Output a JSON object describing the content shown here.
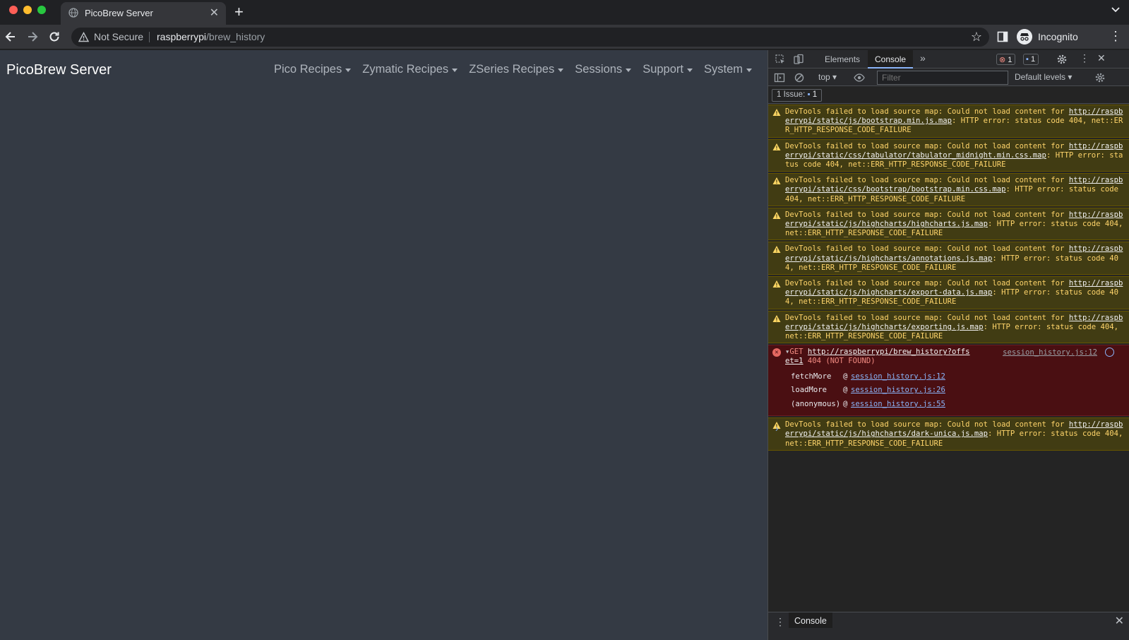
{
  "browser": {
    "tab_title": "PicoBrew Server",
    "security_label": "Not Secure",
    "url_host": "raspberrypi",
    "url_path": "/brew_history",
    "profile_label": "Incognito"
  },
  "page": {
    "brand": "PicoBrew Server",
    "nav": [
      "Pico Recipes",
      "Zymatic Recipes",
      "ZSeries Recipes",
      "Sessions",
      "Support",
      "System"
    ]
  },
  "devtools": {
    "tabs": [
      "Elements",
      "Console"
    ],
    "active_tab": "Console",
    "error_count": "1",
    "message_count": "1",
    "context": "top",
    "filter_placeholder": "Filter",
    "levels": "Default levels",
    "issues_label": "1 Issue:",
    "issues_count": "1",
    "warning_prefix": "DevTools failed to load source map: Could not load content for",
    "warnings": [
      {
        "url": "http://raspberrypi/static/js/bootstrap.min.js.map",
        "suffix": ": HTTP error: status code 404, net::ERR_HTTP_RESPONSE_CODE_FAILURE"
      },
      {
        "url": "http://raspberrypi/static/css/tabulator/tabulator_midnight.min.css.map",
        "suffix": ": HTTP error: status code 404, net::ERR_HTTP_RESPONSE_CODE_FAILURE"
      },
      {
        "url": "http://raspberrypi/static/css/bootstrap/bootstrap.min.css.map",
        "suffix": ": HTTP error: status code 404, net::ERR_HTTP_RESPONSE_CODE_FAILURE"
      },
      {
        "url": "http://raspberrypi/static/js/highcharts/highcharts.js.map",
        "suffix": ": HTTP error: status code 404, net::ERR_HTTP_RESPONSE_CODE_FAILURE"
      },
      {
        "url": "http://raspberrypi/static/js/highcharts/annotations.js.map",
        "suffix": ": HTTP error: status code 404, net::ERR_HTTP_RESPONSE_CODE_FAILURE"
      },
      {
        "url": "http://raspberrypi/static/js/highcharts/export-data.js.map",
        "suffix": ": HTTP error: status code 404, net::ERR_HTTP_RESPONSE_CODE_FAILURE"
      },
      {
        "url": "http://raspberrypi/static/js/highcharts/exporting.js.map",
        "suffix": ": HTTP error: status code 404, net::ERR_HTTP_RESPONSE_CODE_FAILURE"
      }
    ],
    "error": {
      "method": "GET",
      "url": "http://raspberrypi/brew_history?offset=1",
      "status": "404 (NOT FOUND)",
      "source": "session_history.js:12",
      "stack": [
        {
          "fn": "fetchMore",
          "at": "@",
          "loc": "session_history.js:12"
        },
        {
          "fn": "loadMore",
          "at": "@",
          "loc": "session_history.js:26"
        },
        {
          "fn": "(anonymous)",
          "at": "@",
          "loc": "session_history.js:55"
        }
      ]
    },
    "last_warning": {
      "url": "http://raspberrypi/static/js/highcharts/dark-unica.js.map",
      "suffix": ": HTTP error: status code 404, net::ERR_HTTP_RESPONSE_CODE_FAILURE"
    },
    "prompt": "›",
    "drawer_tab": "Console"
  }
}
